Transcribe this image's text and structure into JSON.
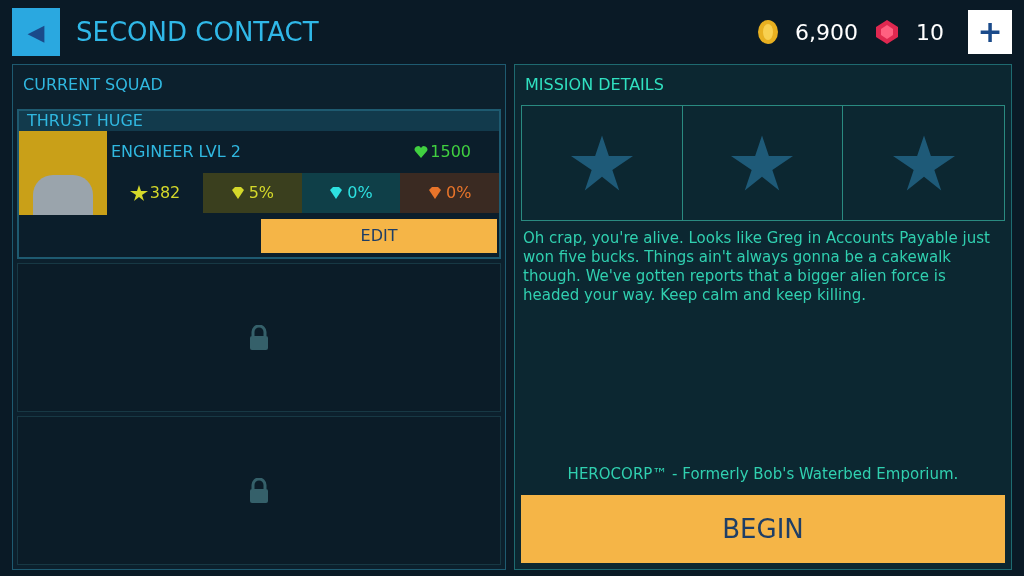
{
  "header": {
    "back": "◀",
    "title": "SECOND CONTACT",
    "coins": "6,900",
    "gems": "10",
    "add": "+"
  },
  "squad": {
    "title": "CURRENT SQUAD",
    "slots": [
      {
        "kind": "hero",
        "name": "THRUST HUGE",
        "class_level": "ENGINEER LVL 2",
        "health": "1500",
        "power": "382",
        "resists": [
          {
            "value": "5%",
            "color": "#d4d82a"
          },
          {
            "value": "0%",
            "color": "#2de0e0"
          },
          {
            "value": "0%",
            "color": "#e8742a"
          }
        ],
        "edit": "EDIT"
      },
      {
        "kind": "locked"
      },
      {
        "kind": "locked"
      }
    ]
  },
  "mission": {
    "title": "MISSION DETAILS",
    "description": "Oh crap, you're alive. Looks like Greg in Accounts Payable just won five bucks. Things ain't always gonna be a cakewalk though. We've gotten reports that a bigger alien force is headed your way. Keep calm and keep killing.",
    "tagline": "HEROCORP™ - Formerly Bob's Waterbed Emporium.",
    "begin": "BEGIN"
  }
}
